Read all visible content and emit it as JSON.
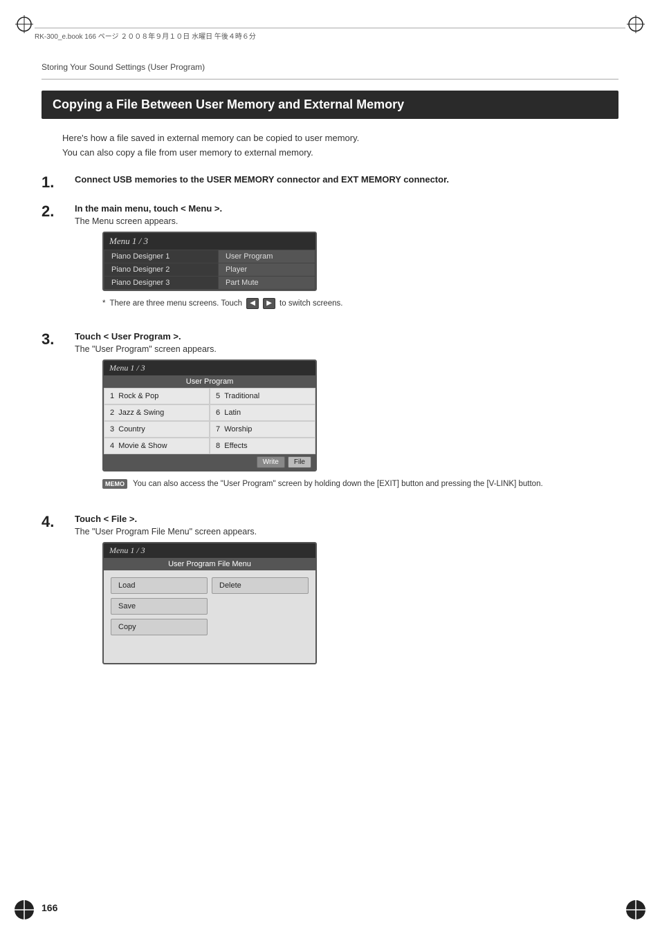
{
  "page": {
    "number": "166",
    "breadcrumb": "Storing Your Sound Settings (User Program)",
    "file_info": "RK-300_e.book  166 ページ  ２００８年９月１０日  水曜日  午後４時６分"
  },
  "heading": {
    "title": "Copying a File Between User Memory and External Memory"
  },
  "intro": {
    "line1": "Here's how a file saved in external memory can be copied to user memory.",
    "line2": "You can also copy a file from user memory to external memory."
  },
  "steps": [
    {
      "number": "1.",
      "title": "Connect USB memories to the USER MEMORY connector and EXT MEMORY connector."
    },
    {
      "number": "2.",
      "title": "In the main menu, touch < Menu >.",
      "sub": "The Menu screen appears."
    },
    {
      "number": "3.",
      "title": "Touch < User Program >.",
      "sub": "The \"User Program\" screen appears."
    },
    {
      "number": "4.",
      "title": "Touch < File >.",
      "sub": "The \"User Program File Menu\" screen appears."
    }
  ],
  "menu_screen": {
    "title": "Menu 1 / 3",
    "rows": [
      {
        "left": "Piano Designer 1",
        "right": "User Program"
      },
      {
        "left": "Piano Designer 2",
        "right": "Player"
      },
      {
        "left": "Piano Designer 3",
        "right": "Part Mute"
      }
    ]
  },
  "note": {
    "text": "There are three menu screens. Touch",
    "text2": "to switch screens."
  },
  "user_program_screen": {
    "title": "Menu 1 / 3",
    "header": "User Program",
    "cells": [
      {
        "num": "1",
        "label": "Rock & Pop"
      },
      {
        "num": "5",
        "label": "Traditional"
      },
      {
        "num": "2",
        "label": "Jazz & Swing"
      },
      {
        "num": "6",
        "label": "Latin"
      },
      {
        "num": "3",
        "label": "Country"
      },
      {
        "num": "7",
        "label": "Worship"
      },
      {
        "num": "4",
        "label": "Movie & Show"
      },
      {
        "num": "8",
        "label": "Effects"
      }
    ],
    "buttons": [
      {
        "label": "Write",
        "active": false
      },
      {
        "label": "File",
        "active": true
      }
    ]
  },
  "memo": {
    "badge": "MEMO",
    "text": "You can also access the \"User Program\" screen by holding down the [EXIT] button and pressing the [V-LINK] button."
  },
  "file_menu_screen": {
    "title": "Menu 1 / 3",
    "header": "User Program File Menu",
    "buttons": [
      {
        "label": "Load",
        "col": 1
      },
      {
        "label": "Delete",
        "col": 2
      },
      {
        "label": "Save",
        "col": 1
      },
      {
        "label": "Copy",
        "col": 1
      }
    ]
  }
}
